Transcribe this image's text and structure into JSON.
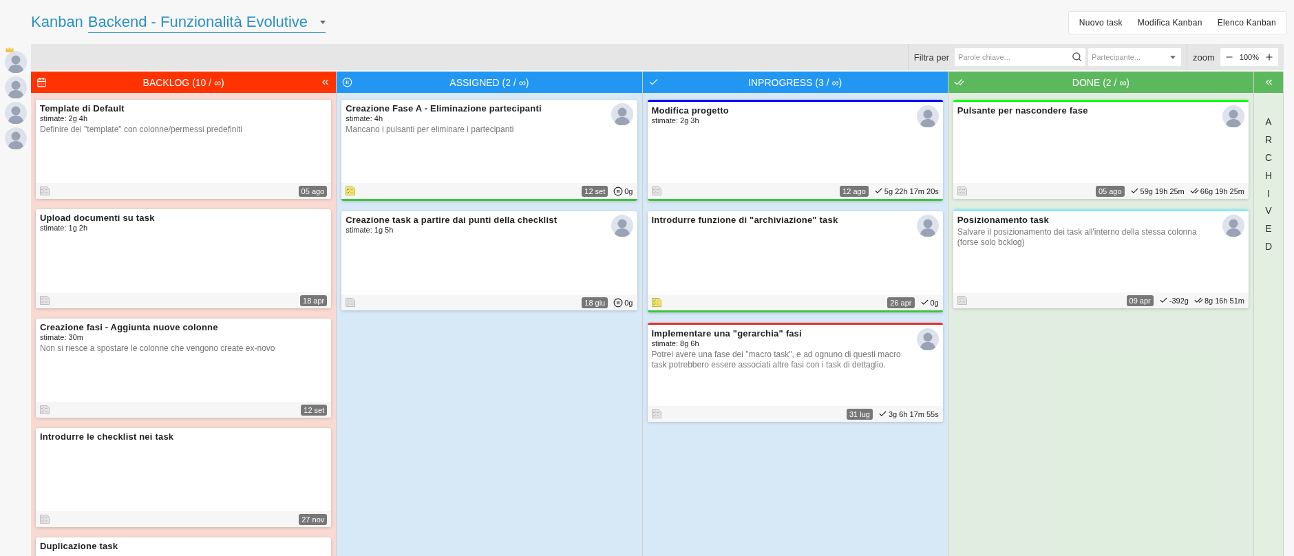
{
  "header": {
    "title_prefix": "Kanban",
    "board_name": "Backend - Funzionalità Evolutive",
    "buttons": [
      "Nuovo task",
      "Modifica Kanban",
      "Elenco Kanban"
    ]
  },
  "participants": [
    {
      "crown": true
    },
    {
      "crown": false
    },
    {
      "crown": false
    },
    {
      "crown": false
    }
  ],
  "toolbar": {
    "filter_label": "Filtra per",
    "search": {
      "placeholder": "Parole chiave..."
    },
    "participant_select": {
      "placeholder": "Partecipante..."
    },
    "zoom_label": "zoom",
    "zoom_value": "100%"
  },
  "columns": [
    {
      "title": "BACKLOG (10 / ∞)",
      "kind": "backlog",
      "color": "#ff3300",
      "collapsible": true,
      "cards": [
        {
          "title": "Template di Default",
          "estimate": "stimate: 2g 4h",
          "description": "Definire dei \"template\" con colonne/permessi predefiniti",
          "has_avatar": false,
          "checklist_active": false,
          "date": "05 ago"
        },
        {
          "title": "Upload documenti su task",
          "estimate": "stimate: 1g 2h",
          "has_avatar": false,
          "checklist_active": false,
          "date": "18 apr"
        },
        {
          "title": "Creazione fasi - Aggiunta nuove colonne",
          "estimate": "stimate: 30m",
          "description": "Non si riesce a spostare le colonne che vengono create ex-novo",
          "has_avatar": false,
          "checklist_active": false,
          "date": "12 set"
        },
        {
          "title": "Introdurre le checklist nei task",
          "has_avatar": false,
          "checklist_active": false,
          "date": "27 nov"
        },
        {
          "title": "Duplicazione task",
          "has_avatar": false,
          "checklist_active": false
        }
      ]
    },
    {
      "title": "ASSIGNED (2 / ∞)",
      "kind": "assigned",
      "color": "#2196f3",
      "collapsible": false,
      "cards": [
        {
          "title": "Creazione Fase A - Eliminazione partecipanti",
          "estimate": "stimate: 4h",
          "description": "Mancano i pulsanti per eliminare i partecipanti",
          "has_avatar": true,
          "checklist_active": true,
          "date": "12 set",
          "timers": [
            {
              "kind": "pause",
              "text": "0g"
            }
          ],
          "complete": true
        },
        {
          "title": "Creazione task a partire dai punti della checklist",
          "estimate": "stimate: 1g 5h",
          "has_avatar": true,
          "checklist_active": false,
          "date": "18 giu",
          "timers": [
            {
              "kind": "pause",
              "text": "0g"
            }
          ],
          "complete": false
        }
      ]
    },
    {
      "title": "INPROGRESS (3 / ∞)",
      "kind": "inprogress",
      "color": "#2196f3",
      "collapsible": false,
      "cards": [
        {
          "title": "Modifica progetto",
          "estimate": "stimate: 2g 3h",
          "has_avatar": true,
          "checklist_active": false,
          "date": "12 ago",
          "timers": [
            {
              "kind": "check",
              "text": "5g 22h 17m 20s"
            }
          ],
          "color": "#0000ff",
          "complete": true
        },
        {
          "title": "Introdurre funzione di \"archiviazione\" task",
          "has_avatar": true,
          "checklist_active": true,
          "date": "26 apr",
          "timers": [
            {
              "kind": "check",
              "text": "0g"
            }
          ],
          "complete": true
        },
        {
          "title": "Implementare una \"gerarchia\" fasi",
          "estimate": "stimate: 8g 6h",
          "description": "Potrei avere una fase dei \"macro task\", e ad ognuno di questi macro task potrebbero essere associati altre fasi con i task di dettaglio.",
          "has_avatar": true,
          "checklist_active": false,
          "date": "31 lug",
          "timers": [
            {
              "kind": "check",
              "text": "3g 6h 17m 55s"
            }
          ],
          "color": "#e53030",
          "complete": false
        }
      ]
    },
    {
      "title": "DONE (2 / ∞)",
      "kind": "done",
      "color": "#5cb85c",
      "collapsible": false,
      "cards": [
        {
          "title": "Pulsante per nascondere fase",
          "has_avatar": true,
          "checklist_active": false,
          "date": "05 ago",
          "timers": [
            {
              "kind": "check",
              "text": "59g 19h 25m"
            },
            {
              "kind": "double",
              "text": "66g 19h 25m"
            }
          ],
          "color": "#00ff00"
        },
        {
          "title": "Posizionamento task",
          "description": "Salvare il posizionamento dei task all'interno della stessa colonna (forse solo bcklog)",
          "has_avatar": true,
          "checklist_active": false,
          "date": "09 apr",
          "timers": [
            {
              "kind": "check",
              "text": "-392g"
            },
            {
              "kind": "double",
              "text": "8g 16h 51m"
            }
          ],
          "color": "#8ceaf8"
        }
      ]
    }
  ],
  "archived": {
    "label": "ARCHIVED"
  }
}
